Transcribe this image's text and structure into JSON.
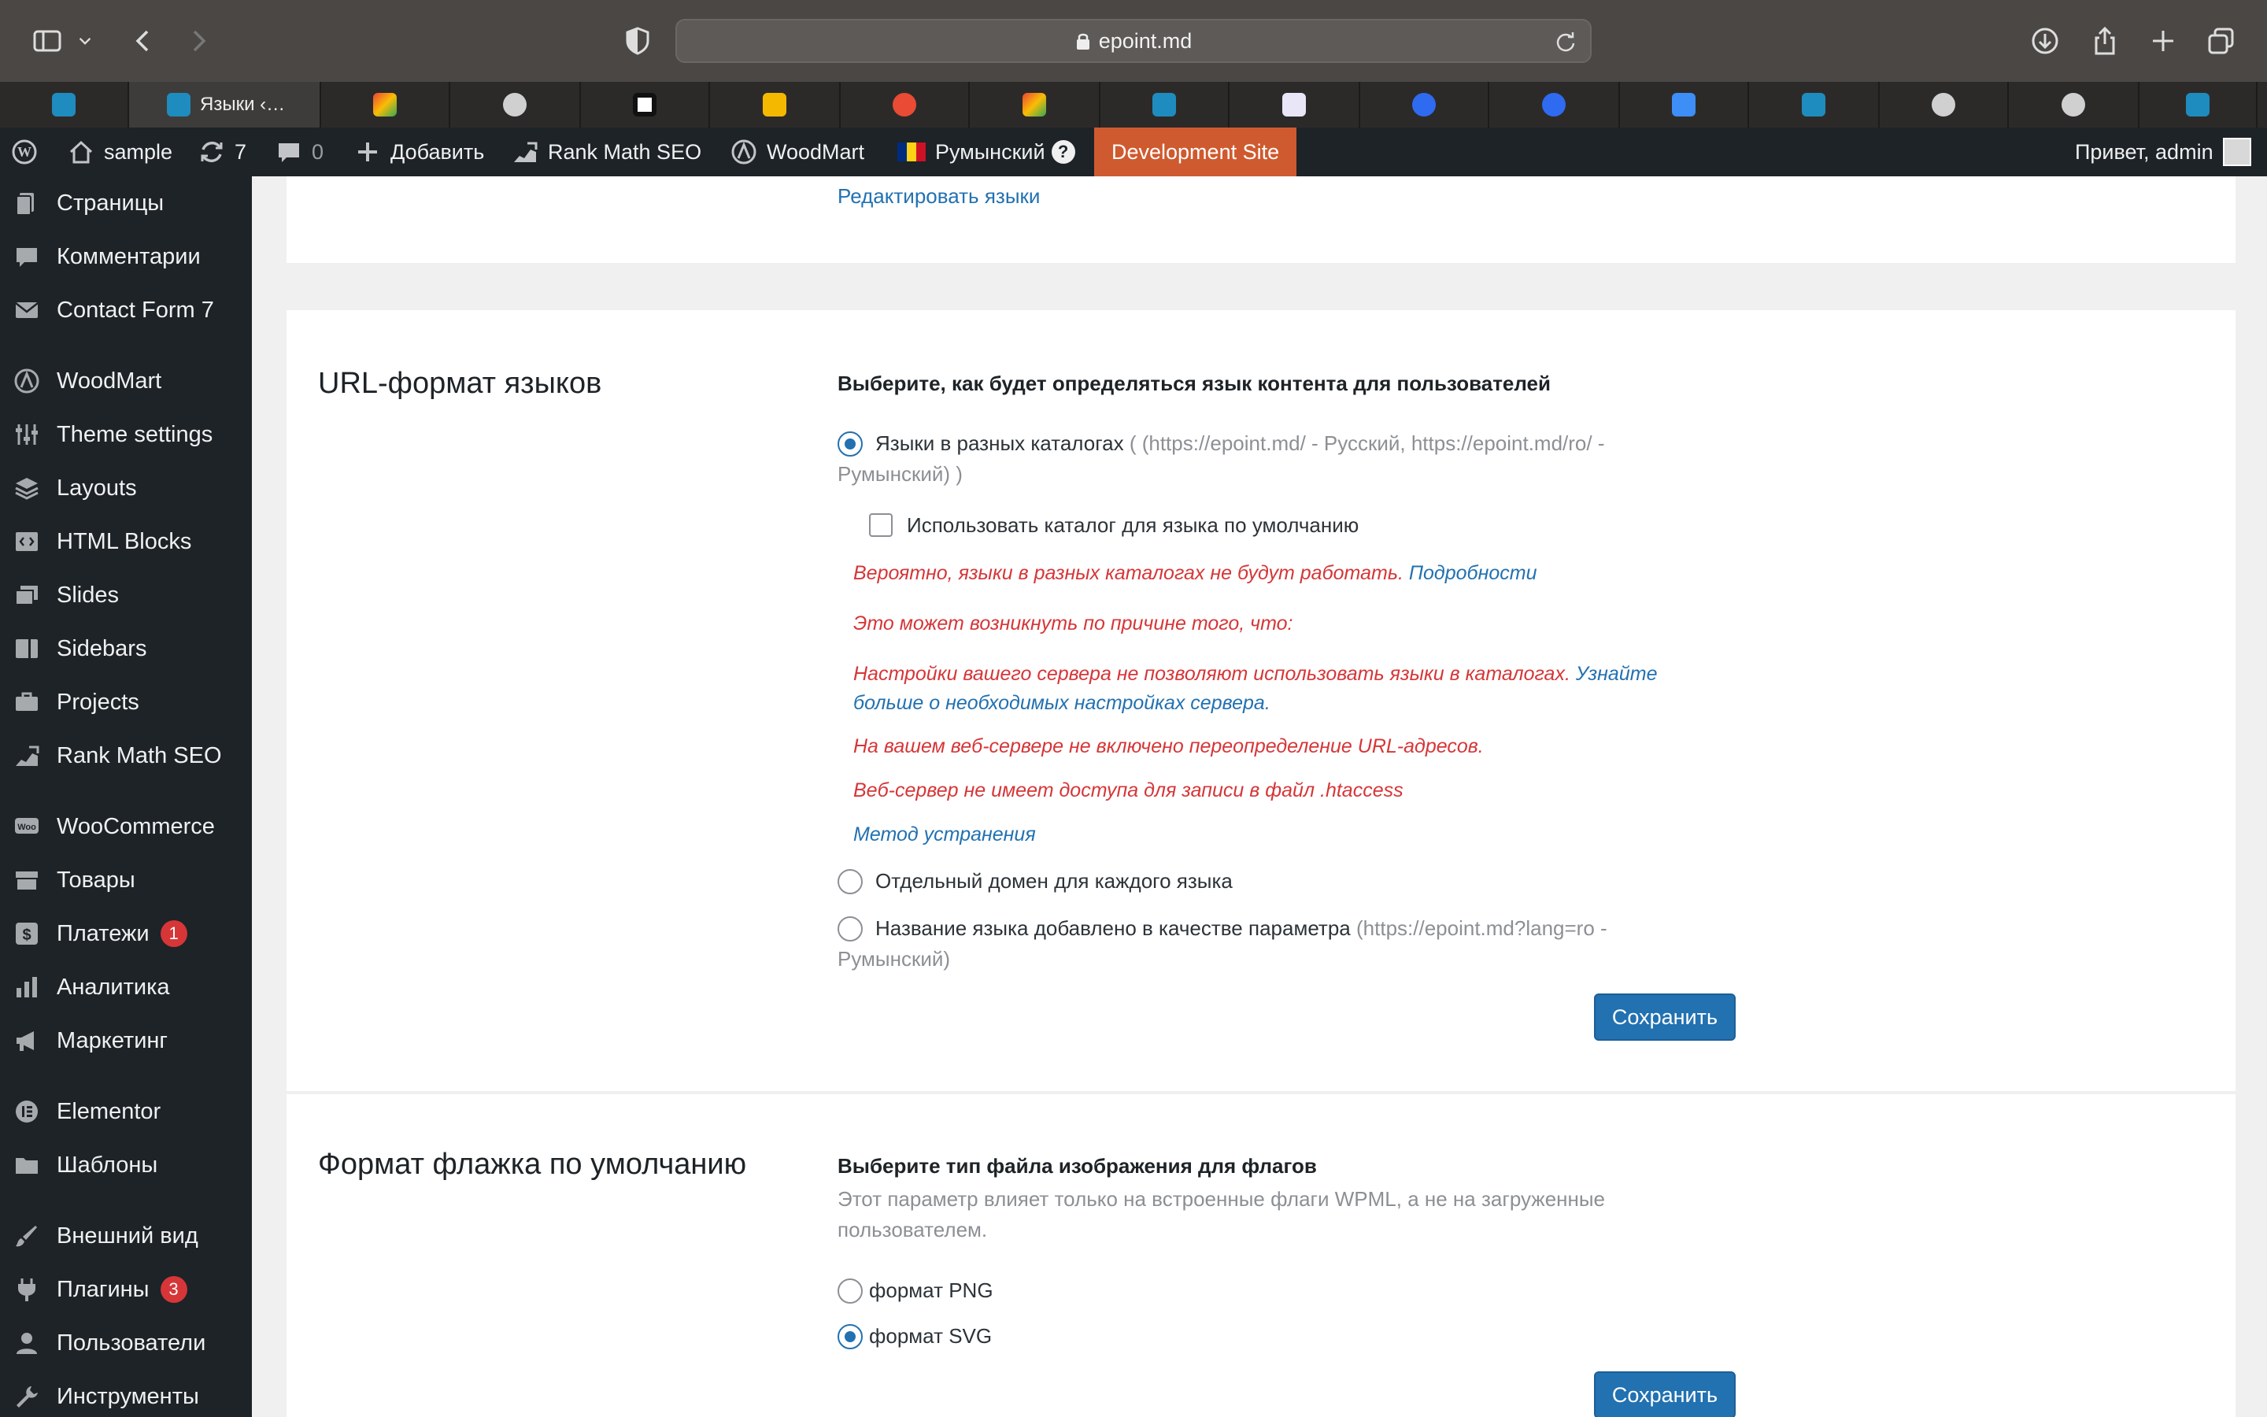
{
  "browser": {
    "url": "epoint.md",
    "active_tab_title": "Языки ‹…",
    "favicons": [
      "wp-blue",
      "wp-blue-active",
      "gmail",
      "grammarly",
      "perplexity",
      "mail-yellow",
      "translate",
      "gmail",
      "wp-blue",
      "finger",
      "mail-at",
      "mail-at",
      "blue-app",
      "wp-blue",
      "grammarly",
      "grammarly",
      "wp-blue"
    ]
  },
  "adminbar": {
    "site": "sample",
    "updates": "7",
    "comments": "0",
    "add_new": "Добавить",
    "rankmath": "Rank Math SEO",
    "woodmart": "WoodMart",
    "language": "Румынский",
    "dev_site": "Development Site",
    "greeting": "Привет, admin"
  },
  "sidebar": {
    "items": [
      {
        "label": "Страницы",
        "icon": "pages-icon"
      },
      {
        "label": "Комментарии",
        "icon": "comments-icon"
      },
      {
        "label": "Contact Form 7",
        "icon": "mail-icon"
      },
      {
        "label": "WoodMart",
        "icon": "woodmart-icon"
      },
      {
        "label": "Theme settings",
        "icon": "sliders-icon"
      },
      {
        "label": "Layouts",
        "icon": "layers-icon"
      },
      {
        "label": "HTML Blocks",
        "icon": "code-icon"
      },
      {
        "label": "Slides",
        "icon": "slides-icon"
      },
      {
        "label": "Sidebars",
        "icon": "sidebar-icon"
      },
      {
        "label": "Projects",
        "icon": "briefcase-icon"
      },
      {
        "label": "Rank Math SEO",
        "icon": "rankmath-icon"
      },
      {
        "label": "WooCommerce",
        "icon": "woo-icon"
      },
      {
        "label": "Товары",
        "icon": "products-icon"
      },
      {
        "label": "Платежи",
        "icon": "payments-icon",
        "badge": "1"
      },
      {
        "label": "Аналитика",
        "icon": "chart-icon"
      },
      {
        "label": "Маркетинг",
        "icon": "megaphone-icon"
      },
      {
        "label": "Elementor",
        "icon": "elementor-icon"
      },
      {
        "label": "Шаблоны",
        "icon": "folder-icon"
      },
      {
        "label": "Внешний вид",
        "icon": "brush-icon"
      },
      {
        "label": "Плагины",
        "icon": "plugin-icon",
        "badge": "3"
      },
      {
        "label": "Пользователи",
        "icon": "users-icon"
      },
      {
        "label": "Инструменты",
        "icon": "tools-icon"
      }
    ]
  },
  "top_card": {
    "edit_languages": "Редактировать языки"
  },
  "url_format": {
    "title": "URL-формат языков",
    "prompt": "Выберите, как будет определяться язык контента для пользователей",
    "opt1_label": "Языки в разных каталогах",
    "opt1_hint": "( (https://epoint.md/ - Русский, https://epoint.md/ro/ - Румынский) )",
    "checkbox_label": "Использовать каталог для языка по умолчанию",
    "warn1": "Вероятно, языки в разных каталогах не будут работать.",
    "warn1_link": "Подробности",
    "warn2": "Это может возникнуть по причине того, что:",
    "warn3": "Настройки вашего сервера не позволяют использовать языки в каталогах.",
    "warn3_link": "Узнайте больше о необходимых настройках сервера.",
    "warn4": "На вашем веб-сервере не включено переопределение URL-адресов.",
    "warn5": "Веб-сервер не имеет доступа для записи в файл .htaccess",
    "fix_link": "Метод устранения",
    "opt2_label": "Отдельный домен для каждого языка",
    "opt3_label": "Название языка добавлено в качестве параметра",
    "opt3_hint": "(https://epoint.md?lang=ro - Румынский)",
    "save": "Сохранить"
  },
  "flag_format": {
    "title": "Формат флажка по умолчанию",
    "prompt": "Выберите тип файла изображения для флагов",
    "desc": "Этот параметр влияет только на встроенные флаги WPML, а не на загруженные пользователем.",
    "png": "формат PNG",
    "svg": "формат SVG",
    "save": "Сохранить"
  }
}
